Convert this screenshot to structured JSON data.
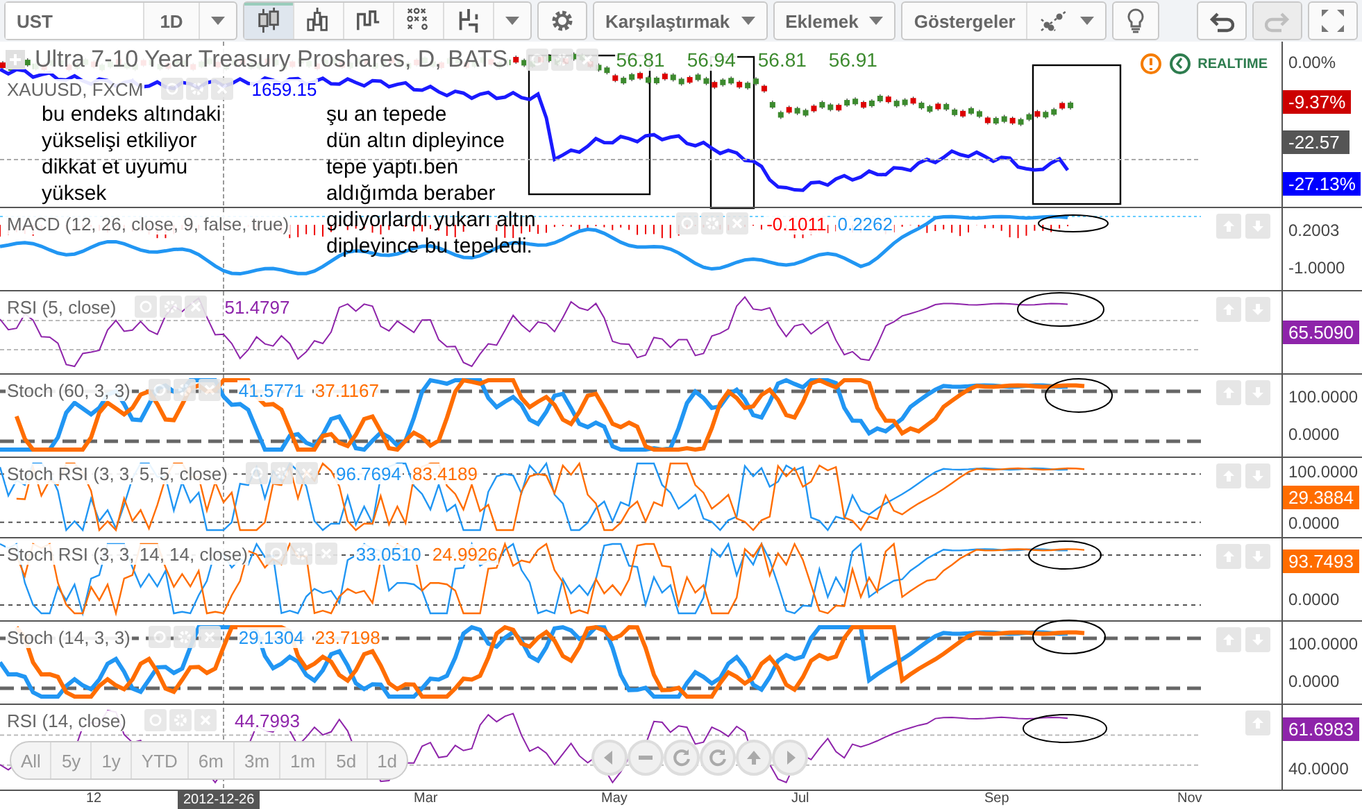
{
  "toolbar": {
    "symbol": "UST",
    "interval": "1D",
    "chart_types": [
      {
        "kind": "candles",
        "selected": true
      },
      {
        "kind": "bars",
        "selected": false
      },
      {
        "kind": "steps",
        "selected": false
      },
      {
        "kind": "point-figure",
        "selected": false
      },
      {
        "kind": "kagi",
        "selected": false
      }
    ],
    "menus": [
      "Karşılaştırmak",
      "Eklemek"
    ],
    "indicators_button": "Göstergeler",
    "actions": [
      {
        "kind": "undo",
        "disabled": false
      },
      {
        "kind": "redo",
        "disabled": true
      },
      {
        "kind": "fullscreen",
        "disabled": false
      }
    ]
  },
  "main_pane": {
    "title": "Ultra 7-10 Year Treasury Proshares, D, BATS",
    "values": [
      "56.81",
      "56.94",
      "56.81",
      "56.91"
    ],
    "compare": {
      "name": "XAUUSD, FXCM",
      "value": "1659.15"
    },
    "status": "REALTIME",
    "axis": [
      {
        "kind": "label",
        "text": "0.00%"
      },
      {
        "kind": "tag",
        "text": "-9.37%",
        "color": "#cc0000"
      },
      {
        "kind": "tag",
        "text": "-22.57",
        "color": "#555555"
      },
      {
        "kind": "tag",
        "text": "-27.13%",
        "color": "#0000ff"
      }
    ]
  },
  "panes": [
    {
      "kind": "macd",
      "title": "MACD (12, 26, close, 9, false, true)",
      "values": [
        {
          "text": "-0.1011",
          "color": "#ff0000"
        },
        {
          "text": "0.2262",
          "color": "#2196f3"
        }
      ],
      "axis": [
        {
          "kind": "label",
          "text": "0.2003"
        },
        {
          "kind": "label",
          "text": "-1.0000"
        }
      ]
    },
    {
      "kind": "rsi",
      "title": "RSI (5, close)",
      "values": [
        {
          "text": "51.4797",
          "color": "#8e24aa"
        }
      ],
      "axis": [
        {
          "kind": "tag",
          "text": "65.5090",
          "color": "#8e24aa"
        }
      ]
    },
    {
      "kind": "stoch",
      "title": "Stoch (60, 3, 3)",
      "values": [
        {
          "text": "41.5771",
          "color": "#2196f3"
        },
        {
          "text": "37.1167",
          "color": "#ff6d00"
        }
      ],
      "axis": [
        {
          "kind": "label",
          "text": "100.0000"
        },
        {
          "kind": "label",
          "text": "0.0000"
        }
      ]
    },
    {
      "kind": "stochrsi",
      "title": "Stoch RSI (3, 3, 5, 5, close)",
      "values": [
        {
          "text": "96.7694",
          "color": "#2196f3"
        },
        {
          "text": "83.4189",
          "color": "#ff6d00"
        }
      ],
      "axis": [
        {
          "kind": "label",
          "text": "100.0000"
        },
        {
          "kind": "tag",
          "text": "29.3884",
          "color": "#ff6d00"
        },
        {
          "kind": "label",
          "text": "0.0000"
        }
      ]
    },
    {
      "kind": "stochrsi",
      "title": "Stoch RSI (3, 3, 14, 14, close)",
      "values": [
        {
          "text": "33.0510",
          "color": "#2196f3"
        },
        {
          "text": "24.9926",
          "color": "#ff6d00"
        }
      ],
      "axis": [
        {
          "kind": "tag",
          "text": "93.7493",
          "color": "#ff6d00"
        },
        {
          "kind": "label",
          "text": "0.0000"
        }
      ]
    },
    {
      "kind": "stoch",
      "title": "Stoch (14, 3, 3)",
      "values": [
        {
          "text": "29.1304",
          "color": "#2196f3"
        },
        {
          "text": "23.7198",
          "color": "#ff6d00"
        }
      ],
      "axis": [
        {
          "kind": "label",
          "text": "100.0000"
        },
        {
          "kind": "label",
          "text": "0.0000"
        }
      ]
    },
    {
      "kind": "rsi",
      "title": "RSI (14, close)",
      "values": [
        {
          "text": "44.7993",
          "color": "#8e24aa"
        }
      ],
      "axis": [
        {
          "kind": "tag",
          "text": "61.6983",
          "color": "#8e24aa"
        },
        {
          "kind": "label",
          "text": "40.0000"
        }
      ]
    }
  ],
  "notes": [
    {
      "lines": [
        "bu endeks altındaki",
        "yükselişi etkiliyor",
        "dikkat et uyumu",
        "yüksek"
      ]
    },
    {
      "lines": [
        "şu an tepede",
        "dün altın dipleyince",
        "tepe yaptı.ben",
        "aldığımda beraber",
        "gidiyorlardı yukarı altın",
        "dipleyince bu tepeledi."
      ]
    }
  ],
  "range_buttons": [
    "All",
    "5y",
    "1y",
    "YTD",
    "6m",
    "3m",
    "1m",
    "5d",
    "1d"
  ],
  "x_axis": {
    "labels": [
      "12",
      "Mar",
      "May",
      "Jul",
      "Sep",
      "Nov"
    ],
    "crosshair_date": "2012-12-26"
  }
}
